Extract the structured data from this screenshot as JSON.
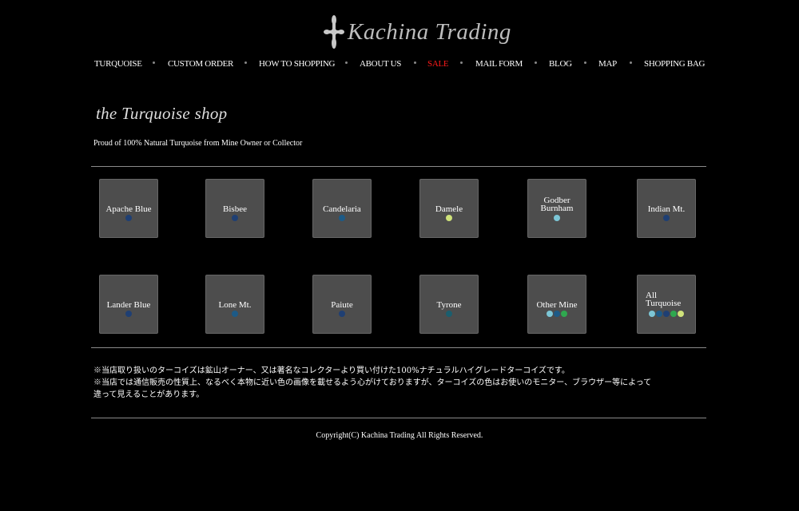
{
  "logo": {
    "text": "Kachina Trading",
    "icon": "fleur-cross-icon"
  },
  "nav": {
    "items": [
      {
        "label": "TURQUOISE",
        "color": "#ffffff"
      },
      {
        "label": "CUSTOM ORDER",
        "color": "#ffffff"
      },
      {
        "label": "HOW TO SHOPPING",
        "color": "#ffffff"
      },
      {
        "label": "ABOUT US",
        "color": "#ffffff"
      },
      {
        "label": "SALE",
        "color": "#ff1a1a"
      },
      {
        "label": "MAIL FORM",
        "color": "#ffffff"
      },
      {
        "label": "BLOG",
        "color": "#ffffff"
      },
      {
        "label": "MAP",
        "color": "#ffffff"
      },
      {
        "label": "SHOPPING BAG",
        "color": "#ffffff"
      }
    ]
  },
  "hero": {
    "title": "the Turquoise shop",
    "subtitle": "Proud of 100% Natural Turquoise from Mine Owner or Collector"
  },
  "tiles": [
    {
      "label": "Apache Blue",
      "dots": [
        "#1f3f73"
      ]
    },
    {
      "label": "Bisbee",
      "dots": [
        "#1f3f73"
      ]
    },
    {
      "label": "Candelaria",
      "dots": [
        "#1d5a86"
      ]
    },
    {
      "label": "Damele",
      "dots": [
        "#cfe27a"
      ]
    },
    {
      "label": "Godber\nBurnham",
      "dots": [
        "#7cc6d6"
      ]
    },
    {
      "label": "Indian Mt.",
      "dots": [
        "#1f3f73"
      ]
    },
    {
      "label": "Lander Blue",
      "dots": [
        "#1f3f73"
      ]
    },
    {
      "label": "Lone Mt.",
      "dots": [
        "#1d5a86"
      ]
    },
    {
      "label": "Paiute",
      "dots": [
        "#1f3f73"
      ]
    },
    {
      "label": "Tyrone",
      "dots": [
        "#1b5e6e"
      ]
    },
    {
      "label": "Other Mine",
      "dots": [
        "#7cc6d6",
        "#1d5a86",
        "#2fa84f"
      ]
    },
    {
      "label": "All\nTurquoise",
      "dots": [
        "#7cc6d6",
        "#1d5a86",
        "#1f3f73",
        "#2fa84f",
        "#cfe27a"
      ]
    }
  ],
  "notes": [
    "※当店取り扱いのターコイズは鉱山オーナー、又は著名なコレクターより買い付けた100%ナチュラルハイグレードターコイズです。",
    "※当店では通信販売の性質上、なるべく本物に近い色の画像を載せるよう心がけておりますが、ターコイズの色はお使いのモニター、ブラウザー等によって",
    "違って見えることがあります。"
  ],
  "footer": {
    "copyright": "Copyright(C) Kachina Trading All Rights Reserved."
  }
}
